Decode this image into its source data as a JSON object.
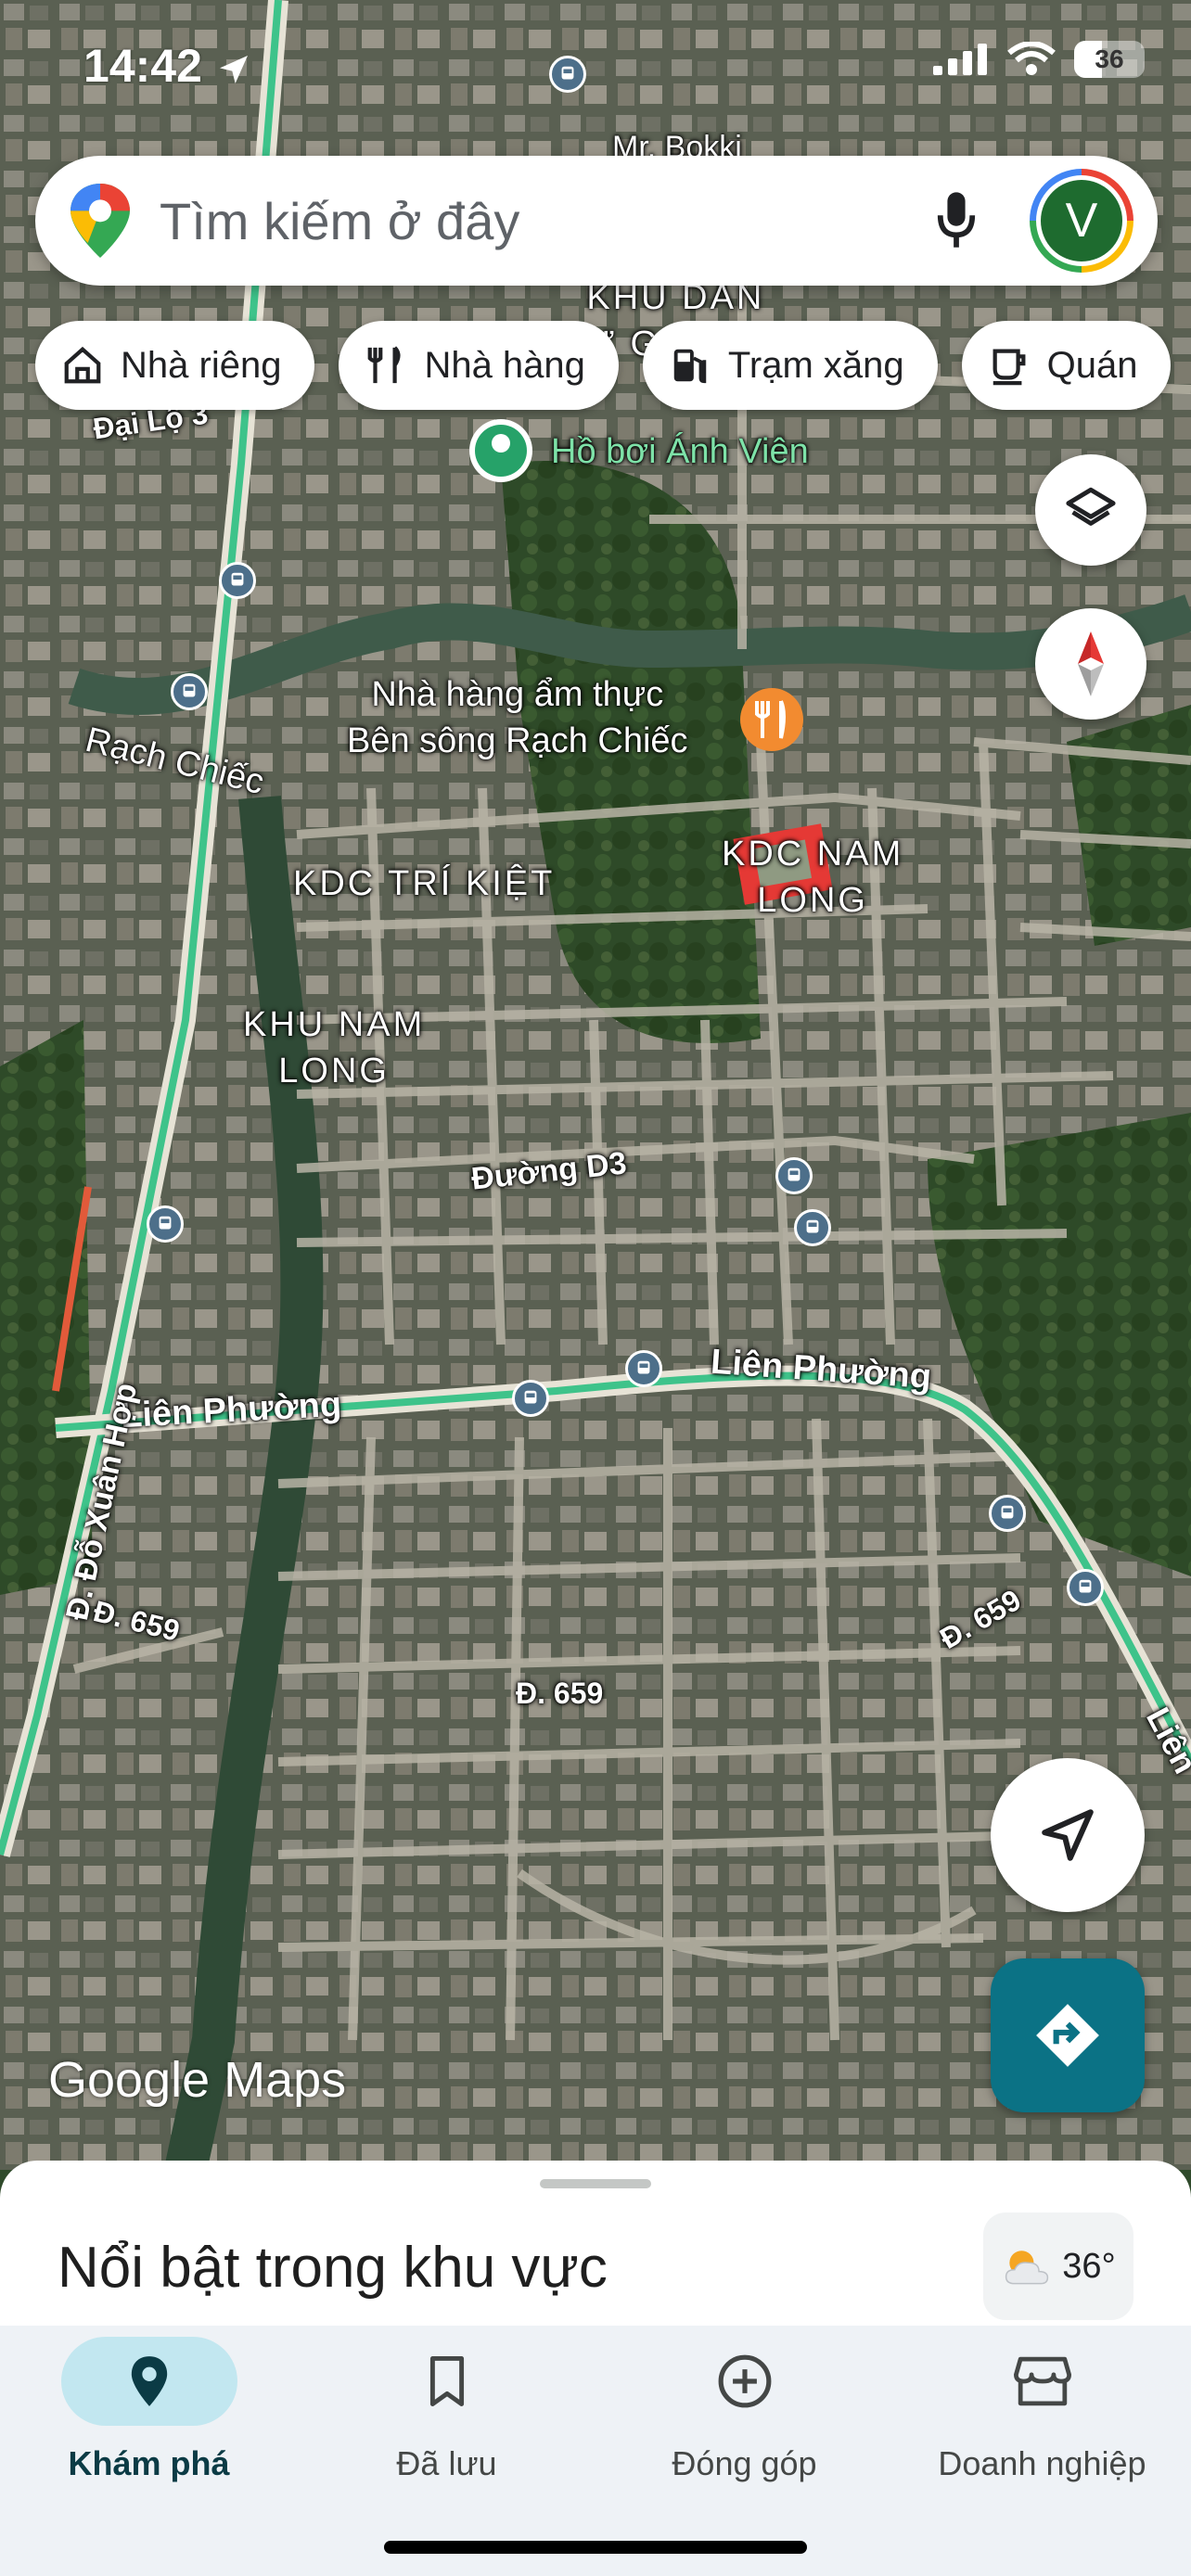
{
  "status_bar": {
    "time": "14:42",
    "battery": "36"
  },
  "search": {
    "placeholder": "Tìm kiếm ở đây",
    "avatar_letter": "V"
  },
  "chips": [
    {
      "label": "Nhà riêng",
      "icon": "home-icon"
    },
    {
      "label": "Nhà hàng",
      "icon": "restaurant-icon"
    },
    {
      "label": "Trạm xăng",
      "icon": "gas-station-icon"
    },
    {
      "label": "Quán",
      "icon": "coffee-icon"
    }
  ],
  "map": {
    "area_labels": {
      "khu_dan_cu": "KHU DÂN\nCƯ GIA HOÀ",
      "kdc_tri_kiet": "KDC TRÍ KIỆT",
      "kdc_nam_long": "KDC NAM\nLONG",
      "khu_nam_long": "KHU NAM\nLONG"
    },
    "road_labels": {
      "dai_lo_3": "Đại Lộ 3",
      "rach_chiec": "Rạch Chiếc",
      "duong_d3": "Đường D3",
      "lien_phuong_left": "Liên Phường",
      "lien_phuong_mid": "Liên Phường",
      "lien_phuong_right": "Liên",
      "do_xuan_hop": "Đ. Đỗ Xuân Hợp",
      "d659_left": "Đ. 659",
      "d659_mid": "Đ. 659",
      "d659_right": "Đ. 659",
      "mr_bokki": "Mr. Bokki"
    },
    "poi": {
      "pool": "Hồ bơi Ánh Viên",
      "restaurant": "Nhà hàng ẩm thực\nBên sông Rạch Chiếc"
    },
    "google_logo": "Google Maps"
  },
  "sheet": {
    "title": "Nổi bật trong khu vực",
    "temperature": "36°"
  },
  "nav": [
    {
      "label": "Khám phá",
      "icon": "explore-pin-icon",
      "active": true
    },
    {
      "label": "Đã lưu",
      "icon": "bookmark-icon",
      "active": false
    },
    {
      "label": "Đóng góp",
      "icon": "add-circle-icon",
      "active": false
    },
    {
      "label": "Doanh nghiệp",
      "icon": "store-icon",
      "active": false
    }
  ],
  "colors": {
    "accent": "#0b7285",
    "nav_active_bg": "#c2e7f0",
    "route": "#3ec38a"
  }
}
